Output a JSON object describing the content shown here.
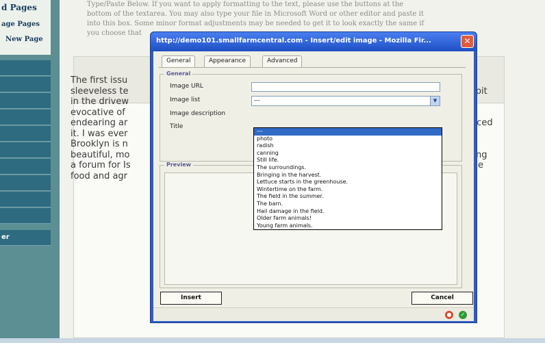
{
  "sidebar": {
    "items": [
      "d Pages",
      "age Pages",
      "New Page"
    ],
    "footer_label": "er"
  },
  "background": {
    "intro_lines": [
      "Type/Paste Below. If you want to apply formatting to the text, please use the buttons at the",
      "bottom of the textarea. You may also type your file in Microsoft Word or other editor and paste it",
      "into this box. Some minor format adjustments may be needed to get it to look exactly the same if",
      "you choose that"
    ],
    "body_left": [
      "The first issu",
      "sleeveless te",
      "in the drivew",
      "evocative of",
      "endearing ar",
      "it. I was ever",
      "Brooklyn is n",
      "beautiful, mo",
      "a forum for Is",
      "food and agr"
    ],
    "body_right": [
      "spit",
      "nced",
      "ng",
      "e"
    ]
  },
  "dialog": {
    "title": "http://demo101.smallfarmcentral.com - Insert/edit image - Mozilla Fir...",
    "close_glyph": "✕",
    "tabs": [
      "General",
      "Appearance",
      "Advanced"
    ],
    "general": {
      "legend": "General",
      "image_url_label": "Image URL",
      "image_url_value": "",
      "image_list_label": "Image list",
      "image_list_selected": "---",
      "image_description_label": "Image description",
      "title_label": "Title"
    },
    "image_list_options": [
      "---",
      "photo",
      "radish",
      "canning",
      "Still life.",
      "The surroundings.",
      "Bringing in the harvest.",
      "Lettuce starts in the greenhouse.",
      "Wintertime on the farm.",
      "The field in the summer.",
      "The barn.",
      "Hail damage in the field.",
      "Older farm animals!",
      "Young farm animals."
    ],
    "preview_legend": "Preview",
    "insert_label": "Insert",
    "cancel_label": "Cancel"
  },
  "colors": {
    "titlebar": "#2f5dc6",
    "sidebar": "#5b8f93",
    "selected_option": "#316ac5",
    "close_button": "#e05a3c"
  }
}
